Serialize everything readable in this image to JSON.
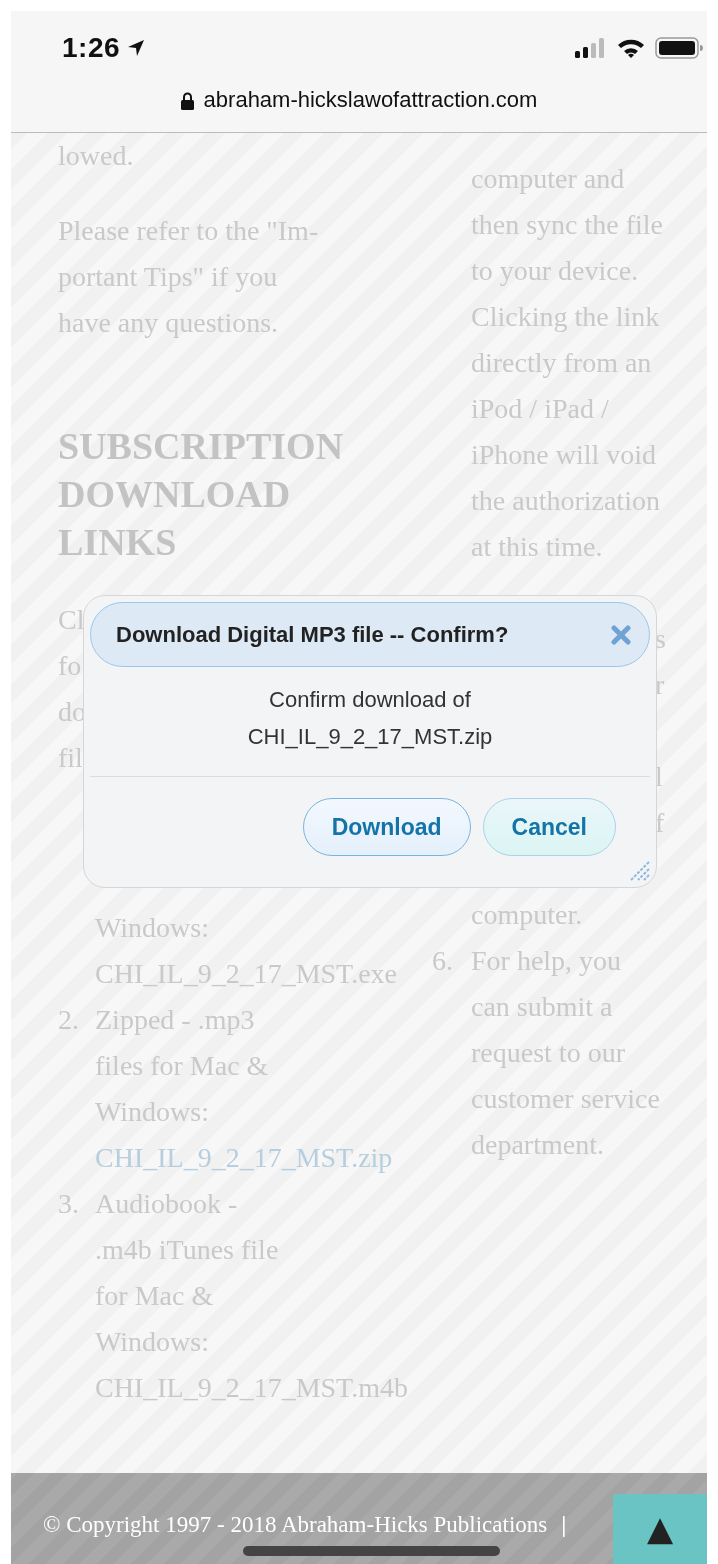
{
  "status_bar": {
    "time": "1:26"
  },
  "address_bar": {
    "url": "abraham-hickslawofattraction.com"
  },
  "page": {
    "left_column": [
      {
        "kind": "paragraph",
        "lines": [
          "lowed."
        ]
      },
      {
        "kind": "paragraph",
        "lines": [
          "Please refer to the \"Im-",
          "portant Tips\" if you",
          "have any questions."
        ]
      },
      {
        "kind": "heading",
        "lines": [
          "SUBSCRIPTION",
          "DOWNLOAD",
          "LINKS"
        ]
      },
      {
        "kind": "fragments",
        "lines": [
          "Cl",
          "fo",
          "do",
          "fil"
        ]
      },
      {
        "kind": "list",
        "items": [
          {
            "lines": [
              "Windows:",
              "CHI_IL_9_2_17_MST.exe"
            ]
          },
          {
            "marker": "2.",
            "lines": [
              "Zipped - .mp3",
              "files for Mac &",
              "Windows:"
            ],
            "link": "CHI_IL_9_2_17_MST.zip"
          },
          {
            "marker": "3.",
            "lines": [
              "Audiobook -",
              ".m4b iTunes file",
              "for Mac &",
              "Windows:",
              "CHI_IL_9_2_17_MST.m4b"
            ]
          }
        ]
      }
    ],
    "right_column": [
      {
        "kind": "paragraph",
        "lines": [
          "computer and",
          "then sync the file",
          "to your device.",
          "Clicking the link",
          "directly from an",
          "iPod / iPad /",
          "iPhone will void",
          "the authorization",
          "at this time."
        ]
      },
      {
        "kind": "fragments",
        "lines": [
          "s",
          "r",
          "l",
          "f"
        ]
      },
      {
        "kind": "list",
        "items": [
          {
            "lines": [
              "computer."
            ]
          },
          {
            "marker": "6.",
            "lines": [
              "For help, you",
              "can submit a",
              "request to our",
              "customer service",
              "department."
            ]
          }
        ]
      }
    ]
  },
  "dialog": {
    "title": "Download Digital MP3 file -- Confirm?",
    "message": [
      "Confirm download of",
      "CHI_IL_9_2_17_MST.zip"
    ],
    "buttons": [
      {
        "label": "Download",
        "kind": "primary"
      },
      {
        "label": "Cancel",
        "kind": "secondary"
      }
    ]
  },
  "footer": {
    "copyright": "© Copyright 1997 - 2018 Abraham-Hicks Publications",
    "separator": "|",
    "back_to_top": "▲"
  }
}
